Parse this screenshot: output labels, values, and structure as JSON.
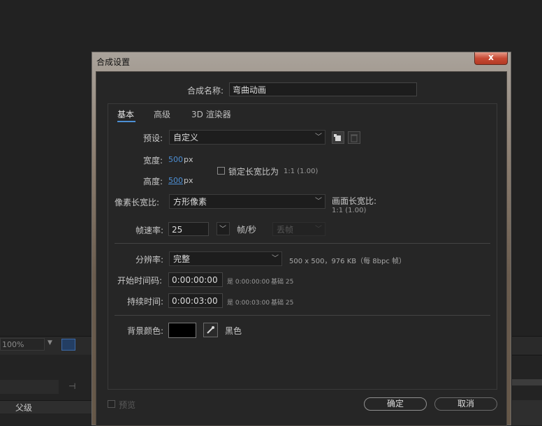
{
  "background": {
    "zoom_value": "100%",
    "timeline_header_label": "父级"
  },
  "dialog": {
    "title": "合成设置",
    "close_glyph": "x",
    "comp_name_label": "合成名称:",
    "comp_name_value": "弯曲动画",
    "tabs": [
      {
        "label": "基本",
        "active": true
      },
      {
        "label": "高级",
        "active": false
      },
      {
        "label": "3D 渲染器",
        "active": false
      }
    ],
    "preset": {
      "label": "预设:",
      "value": "自定义"
    },
    "width": {
      "label": "宽度:",
      "value": "500",
      "unit": "px"
    },
    "height": {
      "label": "高度:",
      "value": "500",
      "unit": "px"
    },
    "lock_aspect": {
      "label": "锁定长宽比为",
      "ratio": "1:1 (1.00)",
      "checked": false
    },
    "pixel_aspect": {
      "label": "像素长宽比:",
      "value": "方形像素"
    },
    "frame_aspect": {
      "label": "画面长宽比:",
      "value": "1:1 (1.00)"
    },
    "frame_rate": {
      "label": "帧速率:",
      "value": "25",
      "unit": "帧/秒",
      "drop_frame": "丢帧"
    },
    "resolution": {
      "label": "分辨率:",
      "value": "完整",
      "info": "500 x 500，976 KB（每 8bpc 帧）"
    },
    "start_timecode": {
      "label": "开始时间码:",
      "value": "0:00:00:00",
      "is_label": "是 0:00:00:00",
      "base": "基础 25"
    },
    "duration": {
      "label": "持续时间:",
      "value": "0:00:03:00",
      "is_label": "是 0:00:03:00",
      "base": "基础 25"
    },
    "bg_color": {
      "label": "背景颜色:",
      "name": "黑色",
      "swatch": "#000000"
    },
    "preview": {
      "label": "预览",
      "checked": false
    },
    "ok_label": "确定",
    "cancel_label": "取消"
  },
  "colors": {
    "accent": "#4d8fd4",
    "title_close": "#c84a34"
  },
  "icons": [
    "new-preset-icon",
    "delete-preset-icon",
    "eyedropper-icon",
    "chevron-down-icon",
    "close-icon"
  ]
}
